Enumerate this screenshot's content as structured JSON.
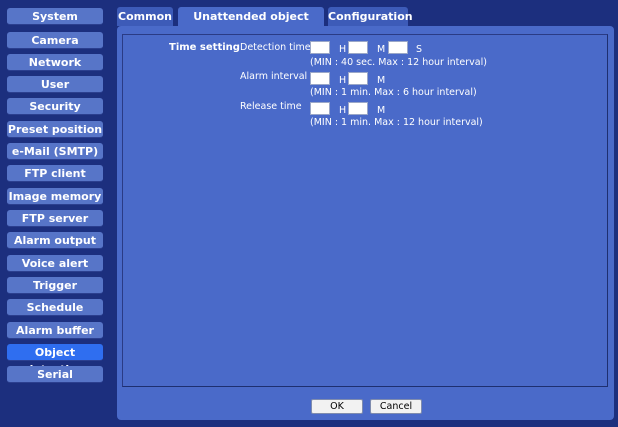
{
  "sidebar": {
    "items": [
      {
        "label": "System"
      },
      {
        "label": "Camera"
      },
      {
        "label": "Network"
      },
      {
        "label": "User"
      },
      {
        "label": "Security"
      },
      {
        "label": "Preset position"
      },
      {
        "label": "e-Mail (SMTP)"
      },
      {
        "label": "FTP client"
      },
      {
        "label": "Image memory"
      },
      {
        "label": "FTP server"
      },
      {
        "label": "Alarm output"
      },
      {
        "label": "Voice alert"
      },
      {
        "label": "Trigger"
      },
      {
        "label": "Schedule"
      },
      {
        "label": "Alarm buffer"
      },
      {
        "label": "Object detection"
      },
      {
        "label": "Serial"
      }
    ],
    "active_index": 15
  },
  "tabs": [
    {
      "label": "Common"
    },
    {
      "label": "Unattended object setting"
    },
    {
      "label": "Configuration"
    }
  ],
  "form": {
    "section_label": "Time setting",
    "detection_time": {
      "label": "Detection time",
      "h_value": "",
      "m_value": "",
      "s_value": "",
      "h_unit": "H",
      "m_unit": "M",
      "s_unit": "S",
      "note": "(MIN : 40 sec. Max : 12 hour interval)"
    },
    "alarm_interval": {
      "label": "Alarm interval",
      "h_value": "",
      "m_value": "",
      "h_unit": "H",
      "m_unit": "M",
      "note": "(MIN : 1 min. Max : 6 hour interval)"
    },
    "release_time": {
      "label": "Release time",
      "h_value": "",
      "m_value": "",
      "h_unit": "H",
      "m_unit": "M",
      "note": "(MIN : 1 min. Max : 12 hour interval)"
    }
  },
  "buttons": {
    "ok": "OK",
    "cancel": "Cancel"
  },
  "colors": {
    "background": "#1c2f7e",
    "panel": "#4a6ac9",
    "nav": "#5775c8",
    "nav_active": "#2f6ef0"
  }
}
